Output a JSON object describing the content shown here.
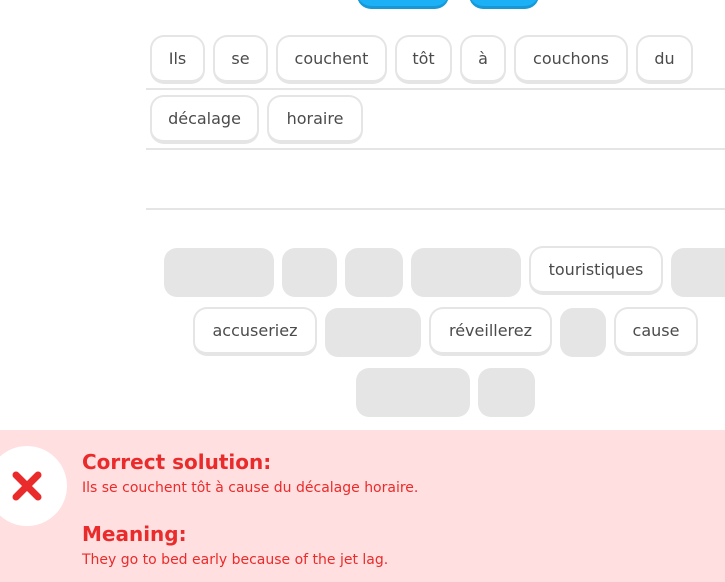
{
  "answer_area": {
    "chips": [
      "Ils",
      "se",
      "couchent",
      "tôt",
      "à",
      "couchons",
      "du",
      "décalage",
      "horaire"
    ]
  },
  "word_bank": {
    "chips": [
      "touristiques",
      "accuseriez",
      "réveillerez",
      "cause"
    ]
  },
  "feedback": {
    "heading": "Correct solution:",
    "solution": "Ils se couchent tôt à cause du décalage horaire.",
    "meaning_heading": "Meaning:",
    "meaning": "They go to bed early because of the jet lag.",
    "status_color": "#ea2b2b",
    "icon": "close-icon"
  }
}
